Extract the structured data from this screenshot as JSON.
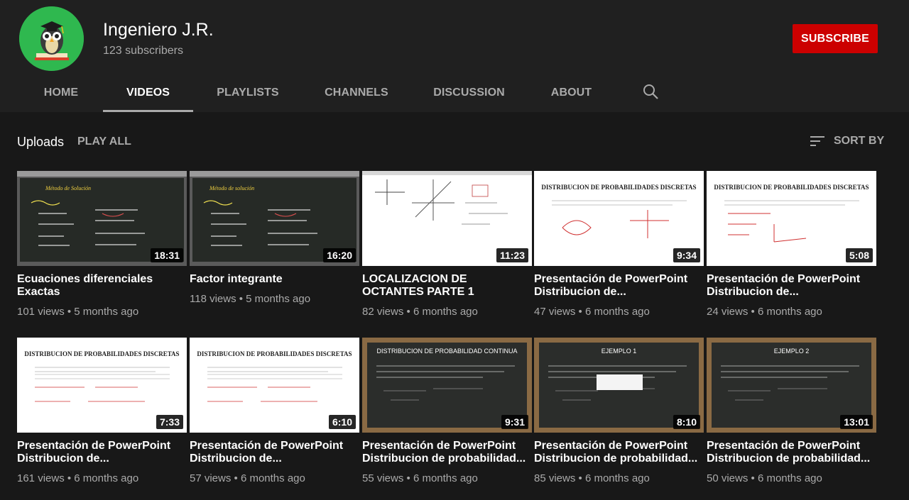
{
  "channel": {
    "name": "Ingeniero J.R.",
    "subscribers": "123 subscribers",
    "subscribe_label": "SUBSCRIBE",
    "avatar_icon": "owl-graduate-icon"
  },
  "tabs": [
    {
      "label": "HOME"
    },
    {
      "label": "VIDEOS"
    },
    {
      "label": "PLAYLISTS"
    },
    {
      "label": "CHANNELS"
    },
    {
      "label": "DISCUSSION"
    },
    {
      "label": "ABOUT"
    }
  ],
  "active_tab": "VIDEOS",
  "section": {
    "title": "Uploads",
    "play_all": "PLAY ALL",
    "sort_by": "SORT BY"
  },
  "videos": [
    {
      "title": "Ecuaciones diferenciales Exactas",
      "meta": "101 views • 5 months ago",
      "duration": "18:31",
      "thumb_text": [
        "Método de Solución"
      ],
      "thumb_style": "chalk-dark"
    },
    {
      "title": "Factor integrante",
      "meta": "118 views • 5 months ago",
      "duration": "16:20",
      "thumb_text": [
        "Método de solución"
      ],
      "thumb_style": "chalk-dark"
    },
    {
      "title": "LOCALIZACION DE OCTANTES PARTE 1",
      "meta": "82 views • 6 months ago",
      "duration": "11:23",
      "thumb_text": [],
      "thumb_style": "whiteboard-axes"
    },
    {
      "title": "Presentación de PowerPoint Distribucion de...",
      "meta": "47 views • 6 months ago",
      "duration": "9:34",
      "thumb_text": [
        "DISTRIBUCION DE PROBABILIDADES DISCRETAS"
      ],
      "thumb_style": "slide-white"
    },
    {
      "title": "Presentación de PowerPoint Distribucion de...",
      "meta": "24 views • 6 months ago",
      "duration": "5:08",
      "thumb_text": [
        "DISTRIBUCION DE PROBABILIDADES DISCRETAS"
      ],
      "thumb_style": "slide-white"
    },
    {
      "title": "Presentación de PowerPoint Distribucion de...",
      "meta": "161 views • 6 months ago",
      "duration": "7:33",
      "thumb_text": [
        "DISTRIBUCION DE PROBABILIDADES DISCRETAS"
      ],
      "thumb_style": "slide-white"
    },
    {
      "title": "Presentación de PowerPoint Distribucion de...",
      "meta": "57 views • 6 months ago",
      "duration": "6:10",
      "thumb_text": [
        "DISTRIBUCION DE PROBABILIDADES DISCRETAS"
      ],
      "thumb_style": "slide-white"
    },
    {
      "title": "Presentación de PowerPoint Distribucion de probabilidad...",
      "meta": "55 views • 6 months ago",
      "duration": "9:31",
      "thumb_text": [
        "DISTRIBUCION DE PROBABILIDAD CONTINUA"
      ],
      "thumb_style": "blackboard-frame"
    },
    {
      "title": "Presentación de PowerPoint Distribucion de probabilidad...",
      "meta": "85 views • 6 months ago",
      "duration": "8:10",
      "thumb_text": [
        "EJEMPLO 1"
      ],
      "thumb_style": "blackboard-frame"
    },
    {
      "title": "Presentación de PowerPoint Distribucion de probabilidad...",
      "meta": "50 views • 6 months ago",
      "duration": "13:01",
      "thumb_text": [
        "EJEMPLO 2"
      ],
      "thumb_style": "blackboard-frame"
    }
  ],
  "colors": {
    "background": "#181818",
    "header": "#202020",
    "subscribe": "#cc0000",
    "avatar": "#2fb84f",
    "muted_text": "#aaaaaa"
  }
}
